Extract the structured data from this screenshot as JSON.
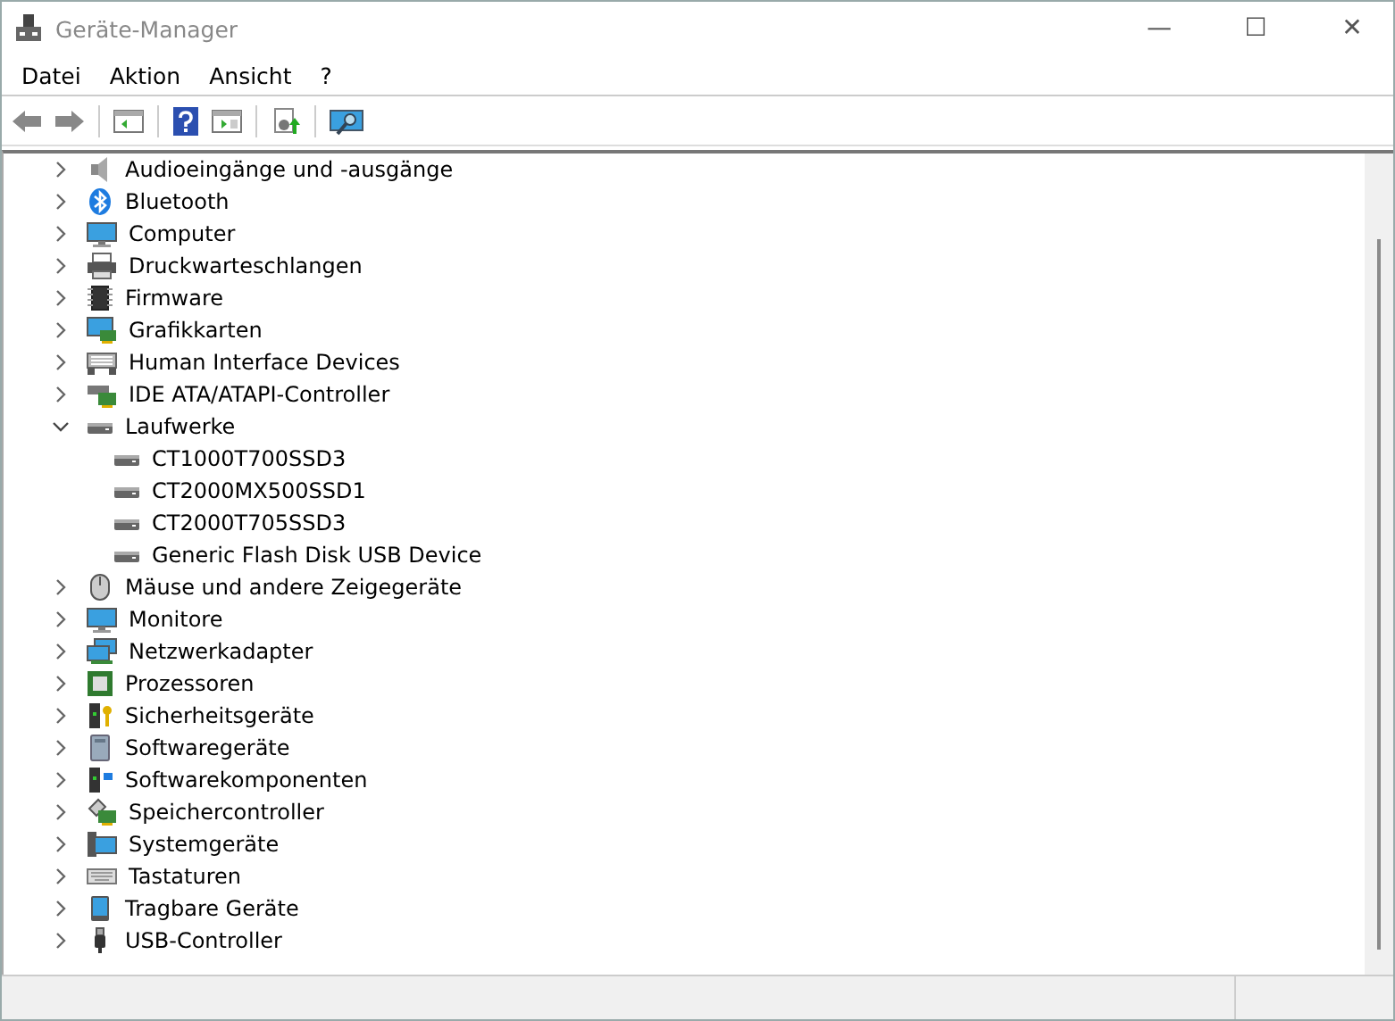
{
  "window": {
    "title": "Geräte-Manager",
    "controls": [
      "—",
      "☐",
      "✕"
    ]
  },
  "menu": [
    "Datei",
    "Aktion",
    "Ansicht",
    "?"
  ],
  "tree": [
    {
      "label": "Audioeingänge und -ausgänge",
      "expanded": false
    },
    {
      "label": "Bluetooth",
      "expanded": false
    },
    {
      "label": "Computer",
      "expanded": false
    },
    {
      "label": "Druckwarteschlangen",
      "expanded": false
    },
    {
      "label": "Firmware",
      "expanded": false
    },
    {
      "label": "Grafikkarten",
      "expanded": false
    },
    {
      "label": "Human Interface Devices",
      "expanded": false
    },
    {
      "label": "IDE ATA/ATAPI-Controller",
      "expanded": false
    },
    {
      "label": "Laufwerke",
      "expanded": true,
      "children": [
        {
          "label": "CT1000T700SSD3"
        },
        {
          "label": "CT2000MX500SSD1"
        },
        {
          "label": "CT2000T705SSD3"
        },
        {
          "label": "Generic Flash Disk USB Device"
        }
      ]
    },
    {
      "label": "Mäuse und andere Zeigegeräte",
      "expanded": false
    },
    {
      "label": "Monitore",
      "expanded": false
    },
    {
      "label": "Netzwerkadapter",
      "expanded": false
    },
    {
      "label": "Prozessoren",
      "expanded": false
    },
    {
      "label": "Sicherheitsgeräte",
      "expanded": false
    },
    {
      "label": "Softwaregeräte",
      "expanded": false
    },
    {
      "label": "Softwarekomponenten",
      "expanded": false
    },
    {
      "label": "Speichercontroller",
      "expanded": false
    },
    {
      "label": "Systemgeräte",
      "expanded": false
    },
    {
      "label": "Tastaturen",
      "expanded": false
    },
    {
      "label": "Tragbare Geräte",
      "expanded": false
    },
    {
      "label": "USB-Controller",
      "expanded": false
    }
  ]
}
